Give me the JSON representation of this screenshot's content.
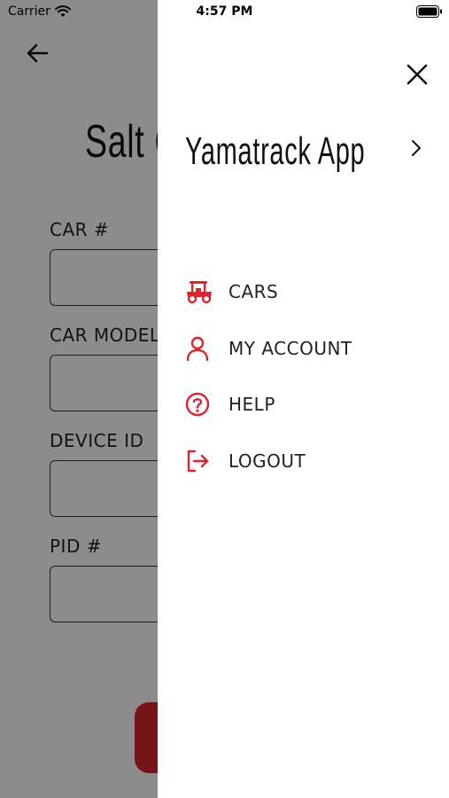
{
  "status_bar": {
    "carrier": "Carrier",
    "time": "4:57 PM"
  },
  "page": {
    "title": "Salt C",
    "fields": [
      {
        "label": "CAR #",
        "value": ""
      },
      {
        "label": "CAR MODEL",
        "value": ""
      },
      {
        "label": "DEVICE ID",
        "value": ""
      },
      {
        "label": "PID #",
        "value": ""
      }
    ]
  },
  "drawer": {
    "title": "Yamatrack App",
    "menu": [
      {
        "label": "CARS",
        "icon": "golf-cart-icon"
      },
      {
        "label": "MY ACCOUNT",
        "icon": "user-icon"
      },
      {
        "label": "HELP",
        "icon": "help-circle-icon"
      },
      {
        "label": "LOGOUT",
        "icon": "logout-icon"
      }
    ],
    "accent_color": "#d9262e"
  }
}
